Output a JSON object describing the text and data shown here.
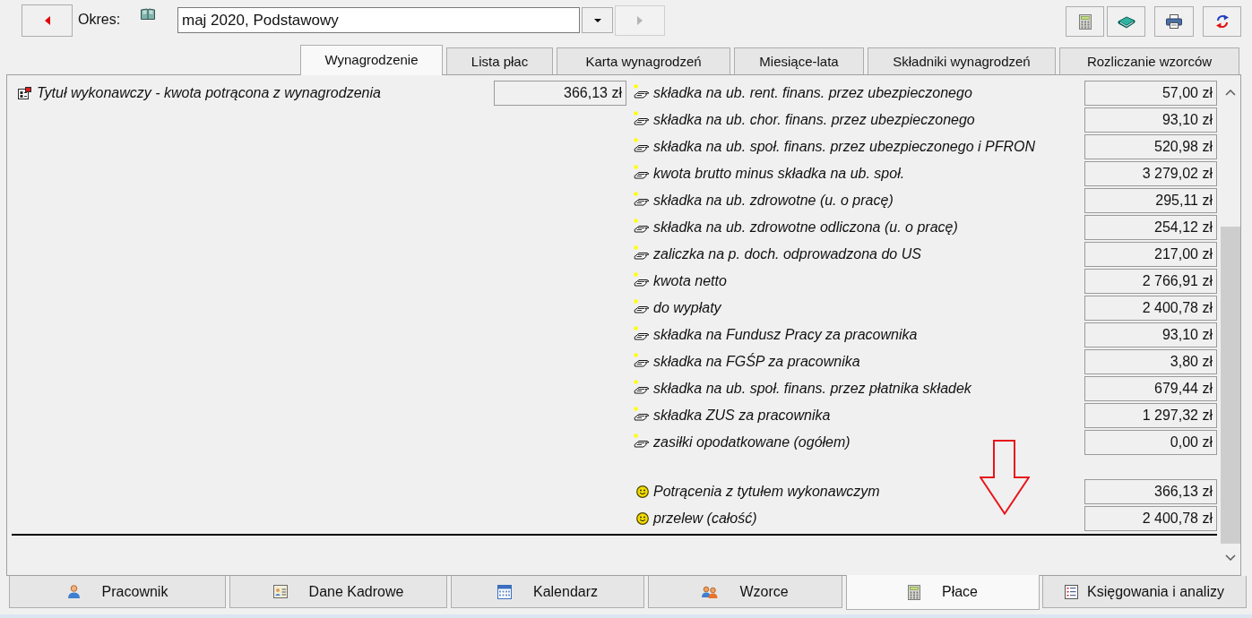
{
  "toolbar": {
    "back_button": {
      "disabled": false
    },
    "period_label": "Okres:",
    "period": {
      "value": "maj 2020, Podstawowy"
    },
    "forward_button": {
      "disabled": true
    }
  },
  "tabs": [
    {
      "label": "Wynagrodzenie",
      "selected": true
    },
    {
      "label": "Lista płac",
      "selected": false
    },
    {
      "label": "Karta wynagrodzeń",
      "selected": false
    },
    {
      "label": "Miesiące-lata",
      "selected": false
    },
    {
      "label": "Składniki wynagrodzeń",
      "selected": false
    },
    {
      "label": "Rozliczanie wzorców",
      "selected": false
    }
  ],
  "deduction": {
    "label": "Tytuł wykonawczy - kwota potrącona z wynagrodzenia",
    "value": "366,13 zł"
  },
  "components": [
    {
      "label": "składka na ub. rent. finans. przez ubezpieczonego",
      "value": "57,00 zł"
    },
    {
      "label": "składka na ub. chor. finans. przez ubezpieczonego",
      "value": "93,10 zł"
    },
    {
      "label": "składka na ub. społ. finans. przez ubezpieczonego i PFRON",
      "value": "520,98 zł"
    },
    {
      "label": "kwota brutto minus składka na ub. społ.",
      "value": "3 279,02 zł"
    },
    {
      "label": "składka na ub. zdrowotne (u. o pracę)",
      "value": "295,11 zł"
    },
    {
      "label": "składka na ub. zdrowotne odliczona (u. o pracę)",
      "value": "254,12 zł"
    },
    {
      "label": "zaliczka na p. doch. odprowadzona do US",
      "value": "217,00 zł"
    },
    {
      "label": "kwota netto",
      "value": "2 766,91 zł"
    },
    {
      "label": "do wypłaty",
      "value": "2 400,78 zł"
    },
    {
      "label": "składka na Fundusz Pracy za pracownika",
      "value": "93,10 zł"
    },
    {
      "label": "składka na FGŚP za pracownika",
      "value": "3,80 zł"
    },
    {
      "label": "składka na ub. społ. finans. przez płatnika składek",
      "value": "679,44 zł"
    },
    {
      "label": "składka ZUS za pracownika",
      "value": "1 297,32 zł"
    },
    {
      "label": "zasiłki opodatkowane (ogółem)",
      "value": "0,00 zł"
    }
  ],
  "summary": [
    {
      "label": "Potrącenia z tytułem wykonawczym",
      "value": "366,13 zł"
    },
    {
      "label": "przelew (całość)",
      "value": "2 400,78 zł"
    }
  ],
  "bottom_tabs": [
    {
      "label": "Pracownik",
      "selected": false
    },
    {
      "label": "Dane Kadrowe",
      "selected": false
    },
    {
      "label": "Kalendarz",
      "selected": false
    },
    {
      "label": "Wzorce",
      "selected": false
    },
    {
      "label": "Płace",
      "selected": true
    },
    {
      "label": "Księgowania i analizy",
      "selected": false
    }
  ]
}
